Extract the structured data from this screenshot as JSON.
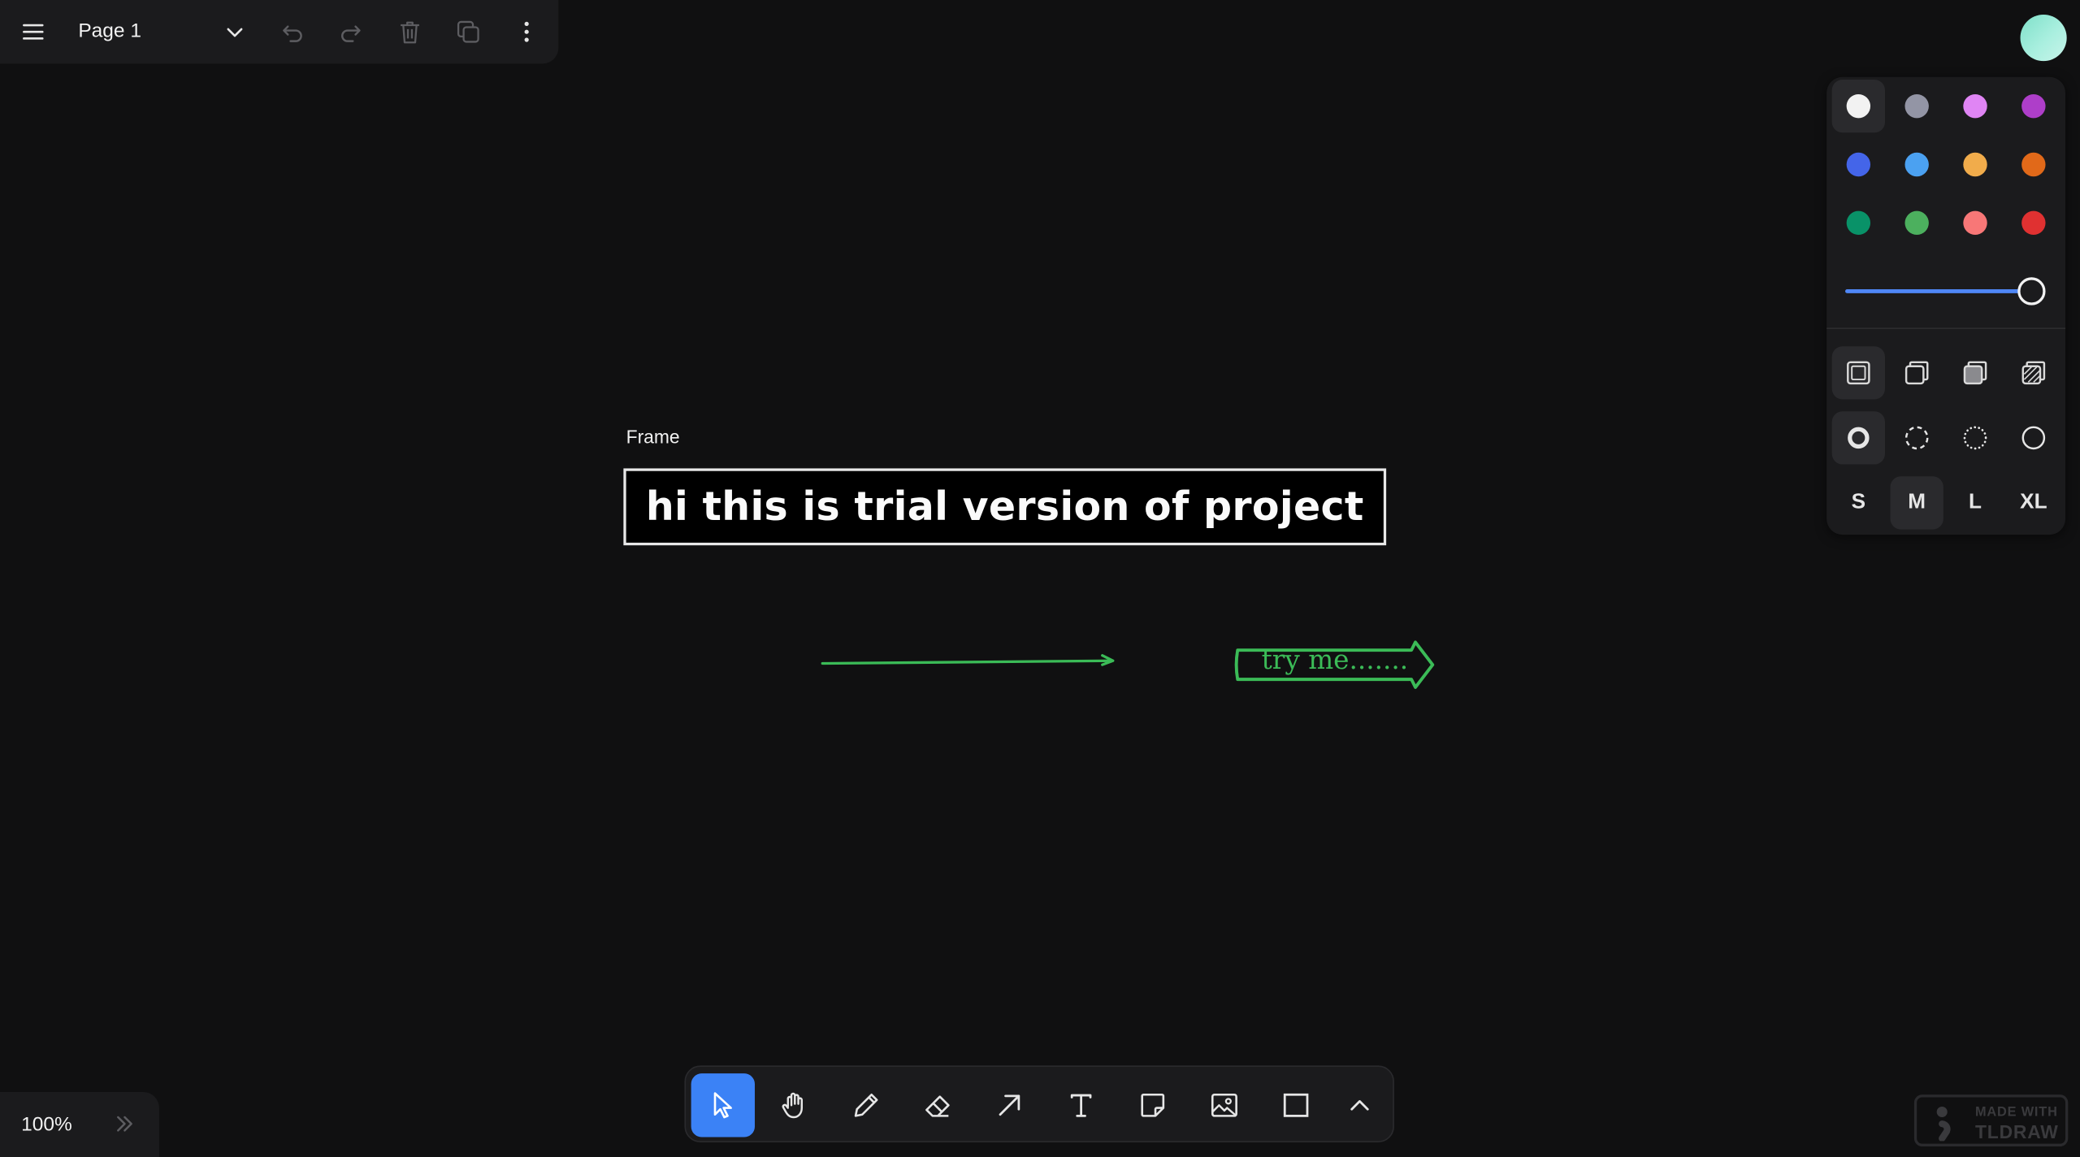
{
  "menu": {
    "page_name": "Page 1"
  },
  "canvas": {
    "frame_label": "Frame",
    "frame_text": "hi this is trial version of project",
    "arrow_shape_text": "try me.......",
    "accent_green": "#3bbb57"
  },
  "style_panel": {
    "colors": [
      {
        "name": "white",
        "hex": "#f2f2f2",
        "selected": true
      },
      {
        "name": "grey",
        "hex": "#9395a5",
        "selected": false
      },
      {
        "name": "light-violet",
        "hex": "#e085f4",
        "selected": false
      },
      {
        "name": "violet",
        "hex": "#ae3ec9",
        "selected": false
      },
      {
        "name": "blue",
        "hex": "#4465e9",
        "selected": false
      },
      {
        "name": "light-blue",
        "hex": "#4ba1f1",
        "selected": false
      },
      {
        "name": "yellow",
        "hex": "#f1ac4b",
        "selected": false
      },
      {
        "name": "orange",
        "hex": "#e16919",
        "selected": false
      },
      {
        "name": "green",
        "hex": "#099268",
        "selected": false
      },
      {
        "name": "light-green",
        "hex": "#4cb05e",
        "selected": false
      },
      {
        "name": "light-red",
        "hex": "#f87777",
        "selected": false
      },
      {
        "name": "red",
        "hex": "#e03131",
        "selected": false
      }
    ],
    "opacity": 1.0,
    "fill_styles": [
      "fill-none-icon",
      "fill-semi-icon",
      "fill-solid-icon",
      "fill-pattern-icon"
    ],
    "dash_styles": [
      "dash-draw-icon",
      "dash-dashed-icon",
      "dash-dotted-icon",
      "dash-solid-icon"
    ],
    "sizes": [
      "S",
      "M",
      "L",
      "XL"
    ],
    "selected_size": "M"
  },
  "toolbar": {
    "tools": [
      {
        "name": "select",
        "icon": "cursor-icon",
        "active": true
      },
      {
        "name": "hand",
        "icon": "hand-icon",
        "active": false
      },
      {
        "name": "draw",
        "icon": "pencil-icon",
        "active": false
      },
      {
        "name": "eraser",
        "icon": "eraser-icon",
        "active": false
      },
      {
        "name": "arrow",
        "icon": "arrow-icon",
        "active": false
      },
      {
        "name": "text",
        "icon": "text-icon",
        "active": false
      },
      {
        "name": "note",
        "icon": "note-icon",
        "active": false
      },
      {
        "name": "image",
        "icon": "image-icon",
        "active": false
      },
      {
        "name": "rectangle",
        "icon": "rectangle-icon",
        "active": false
      },
      {
        "name": "more",
        "icon": "chevron-up-icon",
        "active": false
      }
    ],
    "active_color": "#3b82f6"
  },
  "zoom": {
    "level": "100%"
  },
  "watermark": {
    "line1": "MADE WITH",
    "line2": "TLDRAW"
  }
}
